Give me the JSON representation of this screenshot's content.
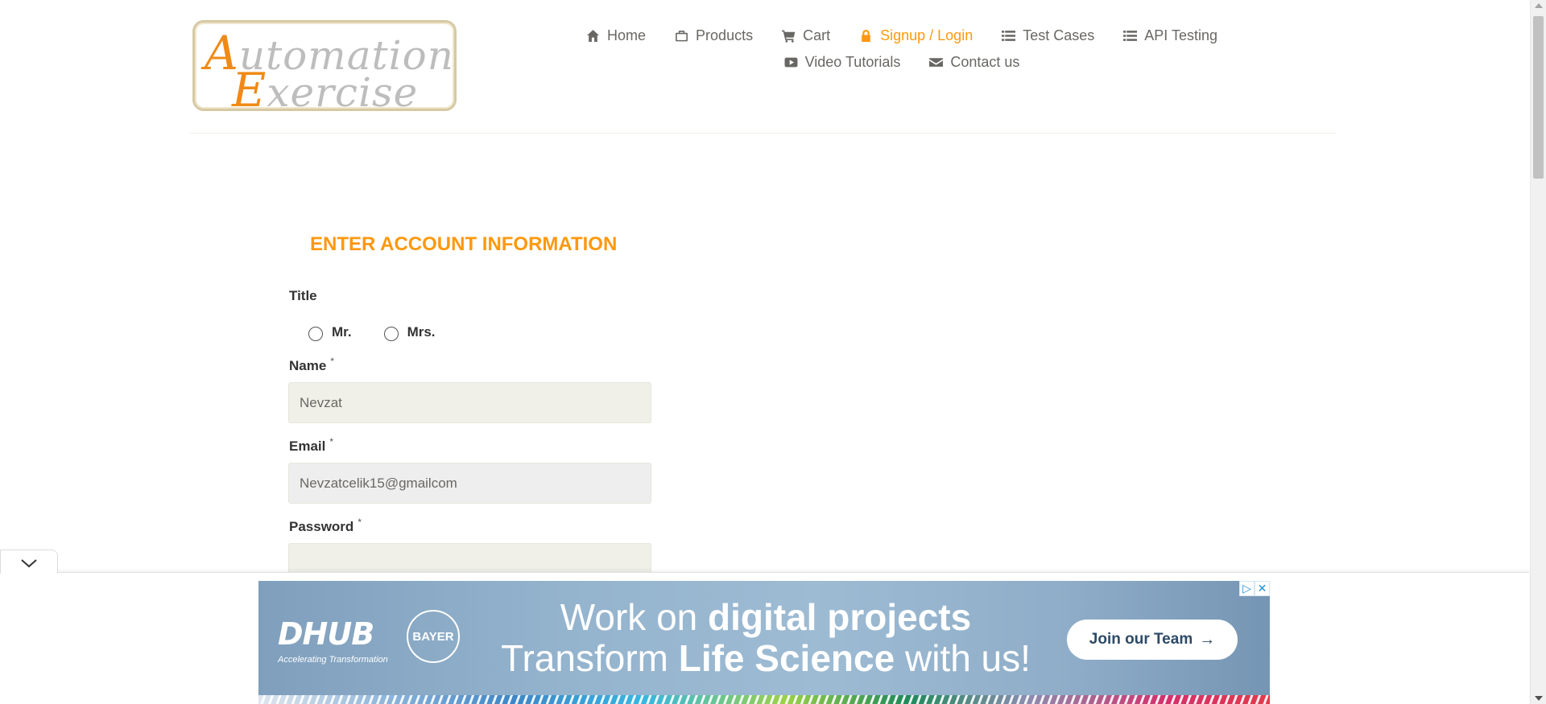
{
  "header": {
    "logo_line1_cap": "A",
    "logo_line1_rest": "utomation",
    "logo_line2_cap": "E",
    "logo_line2_rest": "xercise",
    "nav_row1": [
      {
        "label": "Home",
        "icon": "home-icon"
      },
      {
        "label": "Products",
        "icon": "briefcase-icon"
      },
      {
        "label": "Cart",
        "icon": "cart-icon"
      },
      {
        "label": "Signup / Login",
        "icon": "lock-icon",
        "active": true
      },
      {
        "label": "Test Cases",
        "icon": "list-icon"
      },
      {
        "label": "API Testing",
        "icon": "list-icon"
      }
    ],
    "nav_row2": [
      {
        "label": "Video Tutorials",
        "icon": "youtube-play-icon"
      },
      {
        "label": "Contact us",
        "icon": "envelope-icon"
      }
    ]
  },
  "form": {
    "title": "ENTER ACCOUNT INFORMATION",
    "title_label": "Title",
    "title_options": [
      "Mr.",
      "Mrs."
    ],
    "name_label": "Name",
    "name_value": "Nevzat",
    "email_label": "Email",
    "email_value": "Nevzatcelik15@gmailcom",
    "password_label": "Password",
    "password_value": "",
    "required_mark": "*"
  },
  "ad": {
    "brand": "DHUB",
    "brand_tagline": "Accelerating Transformation",
    "partner_h": "BAYER",
    "partner_v": "BAYER",
    "line1_normal": "Work on ",
    "line1_bold": "digital projects",
    "line2_normal_a": "Transform ",
    "line2_bold": "Life Science",
    "line2_normal_b": " with us!",
    "cta_label": "Join our Team",
    "cta_arrow": "→",
    "info_icon": "▷",
    "close_icon": "✕"
  },
  "colors": {
    "accent": "#fe980f",
    "text": "#696763",
    "input_bg": "#f0f0e9"
  }
}
